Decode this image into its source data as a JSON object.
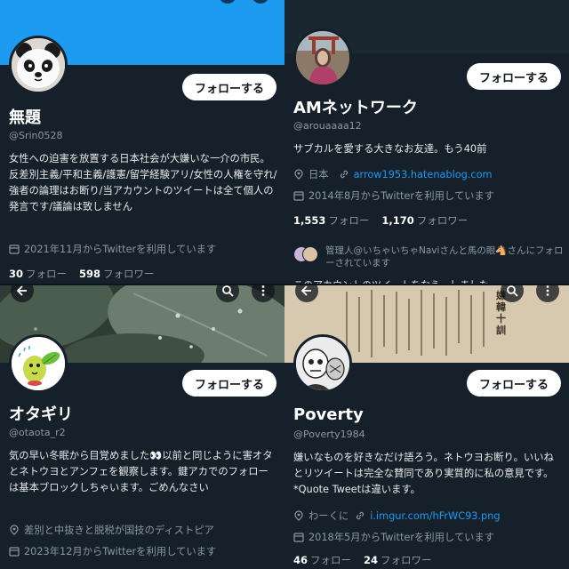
{
  "accent": "#1d9bf0",
  "p1": {
    "name": "無題",
    "handle": "@Srin0528",
    "follow_label": "フォローする",
    "bio": "女性への迫害を放置する日本社会が大嫌いな一介の市民。反差別主義/平和主義/護憲/留学経験アリ/女性の人権を守れ/強者の論理はお断り/当アカウントのツイートは全て個人の発言です/議論は致しません",
    "joined": "2021年11月からTwitterを利用しています",
    "following_count": "30",
    "following_label": "フォロー",
    "followers_count": "598",
    "followers_label": "フォロワー"
  },
  "p2": {
    "name": "AMネットワーク",
    "handle": "@arouaaaa12",
    "follow_label": "フォローする",
    "bio": "サブカルを愛する大きなお友達。もう40前",
    "location": "日本",
    "link": "arrow1953.hatenablog.com",
    "joined": "2014年8月からTwitterを利用しています",
    "following_count": "1,553",
    "following_label": "フォロー",
    "followers_count": "1,170",
    "followers_label": "フォロワー",
    "followed_by": "管理人@いちゃいちゃNaviさんと馬の眼🐴さんにフォローされています",
    "cut_text": "このアカウントのツイートをなう…しました"
  },
  "p3": {
    "name": "オタギリ",
    "handle": "@otaota_r2",
    "follow_label": "フォローする",
    "bio": "気の早い冬眠から目覚めました👀以前と同じように害オタとネトウヨとアンフェを観察します。鍵アカでのフォローは基本ブロックしちゃいます。ごめんなさい",
    "location": "差別と中抜きと脱税が国技のディストピア",
    "joined": "2023年12月からTwitterを利用しています"
  },
  "p4": {
    "name": "Poverty",
    "handle": "@Poverty1984",
    "follow_label": "フォローする",
    "bio": "嫌いなものを好きなだけ語ろう。ネトウヨお断り。いいねとリツイートは完全な賛同であり実質的に私の意見です。*Quote Tweetは違います。",
    "location": "わーくに",
    "link": "i.imgur.com/hFrWC93.png",
    "joined": "2018年5月からTwitterを利用しています",
    "following_count": "46",
    "following_label": "フォロー",
    "followers_count": "24",
    "followers_label": "フォロワー",
    "banner_kanji": "嫌韓十訓"
  }
}
